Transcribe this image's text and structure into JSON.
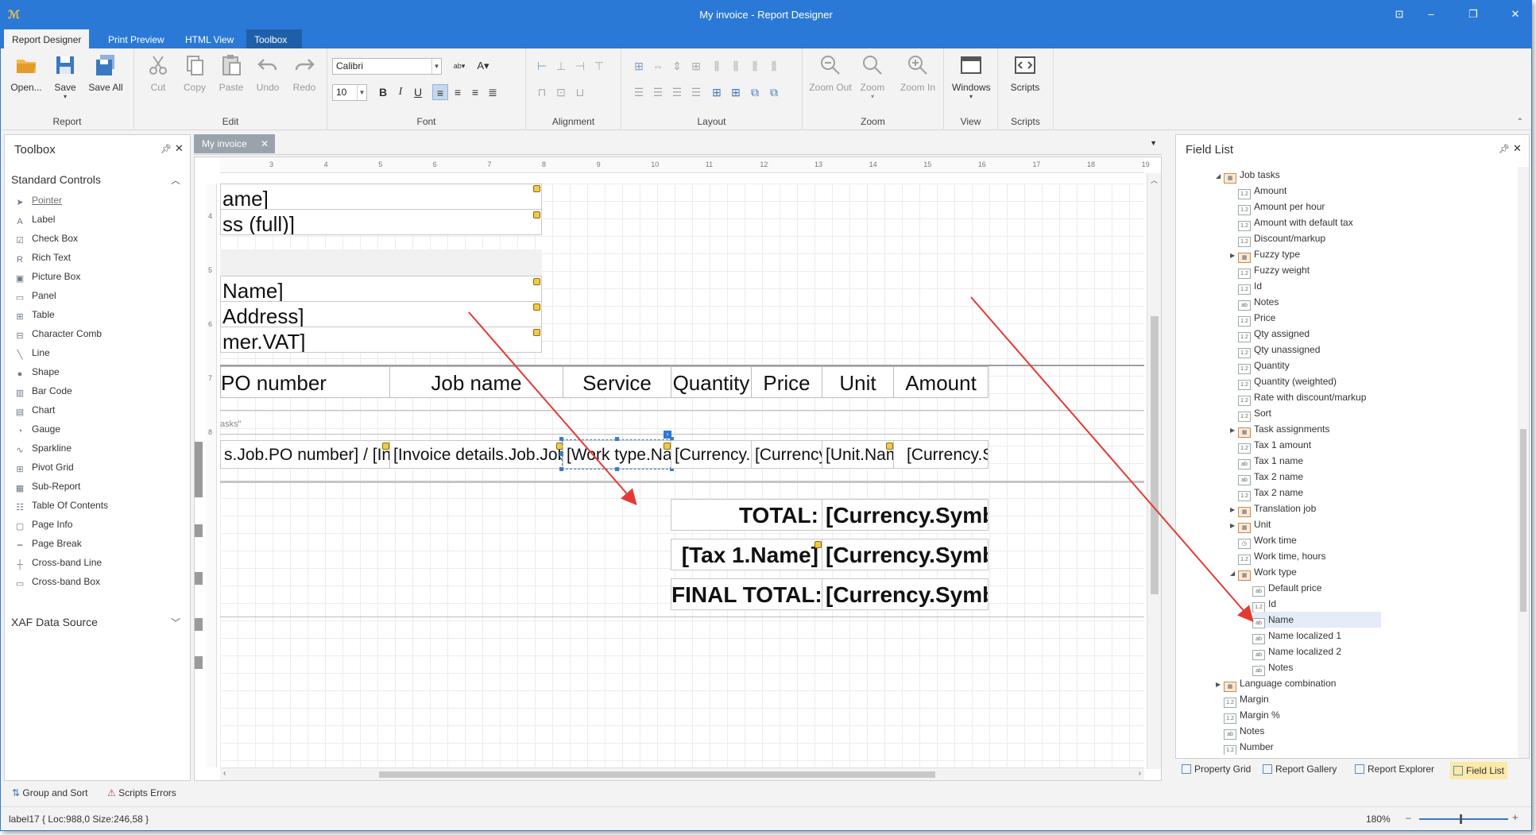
{
  "window": {
    "title": "My invoice - Report Designer"
  },
  "ribbon_tabs": [
    "Report Designer",
    "Print Preview",
    "HTML View",
    "Toolbox"
  ],
  "ribbon": {
    "report": {
      "label": "Report",
      "open": "Open...",
      "save": "Save",
      "save_all": "Save All"
    },
    "edit": {
      "label": "Edit",
      "cut": "Cut",
      "copy": "Copy",
      "paste": "Paste",
      "undo": "Undo",
      "redo": "Redo"
    },
    "font": {
      "label": "Font",
      "family": "Calibri",
      "size": "10"
    },
    "alignment": {
      "label": "Alignment"
    },
    "layout": {
      "label": "Layout"
    },
    "zoom": {
      "label": "Zoom",
      "zoom_out": "Zoom Out",
      "zoom": "Zoom",
      "zoom_in": "Zoom In"
    },
    "view": {
      "label": "View",
      "windows": "Windows"
    },
    "scripts": {
      "label": "Scripts",
      "scripts": "Scripts"
    }
  },
  "toolbox": {
    "title": "Toolbox",
    "standard_controls": "Standard Controls",
    "items": [
      "Pointer",
      "Label",
      "Check Box",
      "Rich Text",
      "Picture Box",
      "Panel",
      "Table",
      "Character Comb",
      "Line",
      "Shape",
      "Bar Code",
      "Chart",
      "Gauge",
      "Sparkline",
      "Pivot Grid",
      "Sub-Report",
      "Table Of Contents",
      "Page Info",
      "Page Break",
      "Cross-band Line",
      "Cross-band Box"
    ],
    "xaf_data_source": "XAF Data Source"
  },
  "document_tab": "My invoice",
  "ruler_numbers": [
    "3",
    "4",
    "5",
    "6",
    "7",
    "8",
    "9",
    "10",
    "11",
    "12",
    "13",
    "14",
    "15",
    "16",
    "17",
    "18",
    "19"
  ],
  "ruler_left_numbers": [
    "4",
    "5",
    "6",
    "7",
    "8"
  ],
  "report": {
    "fields_top": [
      "ame]",
      "ss (full)]",
      "Name]",
      "Address]",
      "mer.VAT]"
    ],
    "headers": [
      "PO number",
      "Job name",
      "Service",
      "Quantity",
      "Price",
      "Unit",
      "Amount"
    ],
    "band_title": "asks\"",
    "row": [
      "s.Job.PO number] / [Invoic",
      "[Invoice details.Job.Job na",
      "[Work type.Na",
      "[Currency.S",
      "[Currency.",
      "[Unit.Nam",
      "[Currency.Sy"
    ],
    "totals": [
      {
        "label": "TOTAL:",
        "value": "[Currency.Symbo"
      },
      {
        "label": "[Tax 1.Name]",
        "value": "[Currency.Symbo"
      },
      {
        "label": "FINAL TOTAL:",
        "value": "[Currency.Symbo"
      }
    ]
  },
  "field_list": {
    "title": "Field List",
    "nodes": [
      {
        "label": "Job tasks",
        "level": 0,
        "type": "table",
        "expander": "◢"
      },
      {
        "label": "Amount",
        "level": 1,
        "type": "num"
      },
      {
        "label": "Amount per hour",
        "level": 1,
        "type": "num"
      },
      {
        "label": "Amount with default tax",
        "level": 1,
        "type": "num"
      },
      {
        "label": "Discount/markup",
        "level": 1,
        "type": "num"
      },
      {
        "label": "Fuzzy type",
        "level": 1,
        "type": "table",
        "expander": "▶"
      },
      {
        "label": "Fuzzy weight",
        "level": 1,
        "type": "num"
      },
      {
        "label": "Id",
        "level": 1,
        "type": "num"
      },
      {
        "label": "Notes",
        "level": 1,
        "type": "text"
      },
      {
        "label": "Price",
        "level": 1,
        "type": "num"
      },
      {
        "label": "Qty assigned",
        "level": 1,
        "type": "num"
      },
      {
        "label": "Qty unassigned",
        "level": 1,
        "type": "num"
      },
      {
        "label": "Quantity",
        "level": 1,
        "type": "num"
      },
      {
        "label": "Quantity (weighted)",
        "level": 1,
        "type": "num"
      },
      {
        "label": "Rate with discount/markup",
        "level": 1,
        "type": "num"
      },
      {
        "label": "Sort",
        "level": 1,
        "type": "num"
      },
      {
        "label": "Task assignments",
        "level": 1,
        "type": "table",
        "expander": "▶"
      },
      {
        "label": "Tax 1 amount",
        "level": 1,
        "type": "num"
      },
      {
        "label": "Tax 1 name",
        "level": 1,
        "type": "text"
      },
      {
        "label": "Tax 2 name",
        "level": 1,
        "type": "text"
      },
      {
        "label": "Tax 2 name",
        "level": 1,
        "type": "num"
      },
      {
        "label": "Translation job",
        "level": 1,
        "type": "table",
        "expander": "▶"
      },
      {
        "label": "Unit",
        "level": 1,
        "type": "table",
        "expander": "▶"
      },
      {
        "label": "Work time",
        "level": 1,
        "type": "time"
      },
      {
        "label": "Work time, hours",
        "level": 1,
        "type": "num"
      },
      {
        "label": "Work type",
        "level": 1,
        "type": "table",
        "expander": "◢"
      },
      {
        "label": "Default price",
        "level": 2,
        "type": "text"
      },
      {
        "label": "Id",
        "level": 2,
        "type": "num"
      },
      {
        "label": "Name",
        "level": 2,
        "type": "text",
        "selected": true
      },
      {
        "label": "Name localized 1",
        "level": 2,
        "type": "text"
      },
      {
        "label": "Name localized 2",
        "level": 2,
        "type": "text"
      },
      {
        "label": "Notes",
        "level": 2,
        "type": "text"
      },
      {
        "label": "Language combination",
        "level": 0,
        "type": "table",
        "expander": "▶"
      },
      {
        "label": "Margin",
        "level": 0,
        "type": "num"
      },
      {
        "label": "Margin %",
        "level": 0,
        "type": "num"
      },
      {
        "label": "Notes",
        "level": 0,
        "type": "text"
      },
      {
        "label": "Number",
        "level": 0,
        "type": "num"
      }
    ]
  },
  "bottom_tabs": [
    "Property Grid",
    "Report Gallery",
    "Report Explorer",
    "Field List"
  ],
  "lower_bar": {
    "group_sort": "Group and Sort",
    "scripts_errors": "Scripts Errors"
  },
  "status": {
    "left": "label17 { Loc:988,0 Size:246,58 }",
    "zoom": "180%"
  }
}
